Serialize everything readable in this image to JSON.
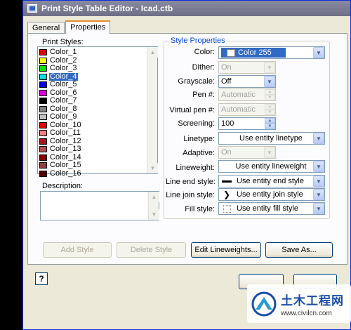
{
  "window": {
    "title": "Print Style Table Editor - Icad.ctb"
  },
  "tabs": [
    {
      "label": "General",
      "active": false
    },
    {
      "label": "Properties",
      "active": true
    }
  ],
  "print_styles": {
    "label": "Print Styles:",
    "items": [
      {
        "label": "Color_1",
        "color": "#e00000"
      },
      {
        "label": "Color_2",
        "color": "#ffff00"
      },
      {
        "label": "Color_3",
        "color": "#00e000"
      },
      {
        "label": "Color_4",
        "color": "#00e0e0"
      },
      {
        "label": "Color_5",
        "color": "#0000e0"
      },
      {
        "label": "Color_6",
        "color": "#e000e0"
      },
      {
        "label": "Color_7",
        "color": "#000000"
      },
      {
        "label": "Color_8",
        "color": "#808080"
      },
      {
        "label": "Color_9",
        "color": "#c0c0c0"
      },
      {
        "label": "Color_10",
        "color": "#e00000"
      },
      {
        "label": "Color_11",
        "color": "#f08080"
      },
      {
        "label": "Color_12",
        "color": "#a01818"
      },
      {
        "label": "Color_13",
        "color": "#b05050"
      },
      {
        "label": "Color_14",
        "color": "#800000"
      },
      {
        "label": "Color_15",
        "color": "#904040"
      },
      {
        "label": "Color_16",
        "color": "#500000"
      }
    ],
    "selected_index": 3
  },
  "description": {
    "label": "Description:",
    "value": ""
  },
  "style_properties": {
    "title": "Style Properties",
    "color": {
      "label": "Color:",
      "value": "Color 255",
      "swatch": "#ffffff"
    },
    "dither": {
      "label": "Dither:",
      "value": "On"
    },
    "grayscale": {
      "label": "Grayscale:",
      "value": "Off"
    },
    "pen": {
      "label": "Pen #:",
      "value": "Automatic"
    },
    "virtual_pen": {
      "label": "Virtual pen #:",
      "value": "Automatic"
    },
    "screening": {
      "label": "Screening:",
      "value": "100"
    },
    "linetype": {
      "label": "Linetype:",
      "value": "Use entity linetype"
    },
    "adaptive": {
      "label": "Adaptive:",
      "value": "On"
    },
    "lineweight": {
      "label": "Lineweight:",
      "value": "Use entity lineweight"
    },
    "line_end_style": {
      "label": "Line end style:",
      "value": "Use entity end style"
    },
    "line_join_style": {
      "label": "Line join style:",
      "value": "Use entity join style"
    },
    "fill_style": {
      "label": "Fill style:",
      "value": "Use entity fill style"
    }
  },
  "buttons": {
    "add_style": "Add Style",
    "delete_style": "Delete Style",
    "edit_lineweights": "Edit Lineweights...",
    "save_as": "Save As...",
    "help": "?"
  },
  "watermark": {
    "name": "土木工程网",
    "url": "www.civilcn.com"
  },
  "colors": {
    "selection": "#316ac5",
    "group_title": "#0046d5",
    "tab_accent": "#e68b2c"
  }
}
